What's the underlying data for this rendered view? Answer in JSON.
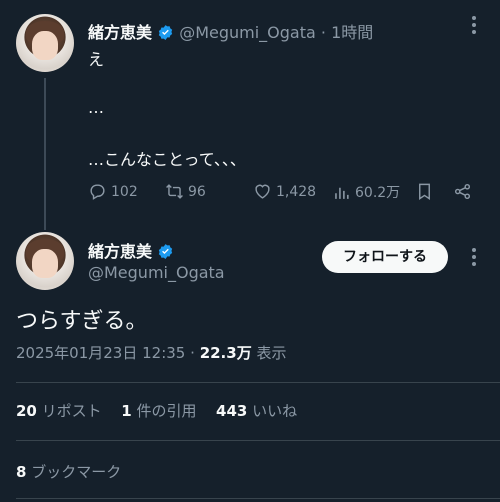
{
  "parent_tweet": {
    "display_name": "緒方恵美",
    "handle": "@Megumi_Ogata",
    "separator": "·",
    "time": "1時間",
    "lines": [
      "え",
      "…",
      "…こんなことって、、、"
    ],
    "actions": {
      "replies": "102",
      "retweets": "96",
      "likes": "1,428",
      "views": "60.2万"
    }
  },
  "main_tweet": {
    "display_name": "緒方恵美",
    "handle": "@Megumi_Ogata",
    "follow_label": "フォローする",
    "text": "つらすぎる。",
    "timestamp": "2025年01月23日 12:35",
    "dot": "·",
    "views_count": "22.3万",
    "views_label": "表示",
    "stats": {
      "reposts_count": "20",
      "reposts_label": "リポスト",
      "quotes_count": "1",
      "quotes_label": "件の引用",
      "likes_count": "443",
      "likes_label": "いいね",
      "bookmarks_count": "8",
      "bookmarks_label": "ブックマーク"
    }
  },
  "colors": {
    "background": "#15202b",
    "text": "#f7f9f9",
    "secondary": "#8b98a5",
    "verified": "#1d9bf0"
  }
}
